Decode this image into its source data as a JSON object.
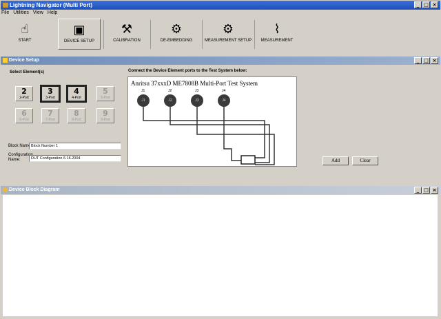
{
  "window": {
    "title": "Lightning Navigator (Multi Port)",
    "controls": [
      "_",
      "□",
      "×"
    ]
  },
  "menu": [
    "File",
    "Utilities",
    "View",
    "Help"
  ],
  "toolbar": [
    {
      "label": "START",
      "icon": "hand-pointer-icon",
      "glyph": "☝"
    },
    {
      "label": "DEVICE SETUP",
      "icon": "chip-icon",
      "glyph": "▣"
    },
    {
      "label": "CALIBRATION",
      "icon": "wrench-icon",
      "glyph": "⚒"
    },
    {
      "label": "DE-EMBEDDING",
      "icon": "network-icon",
      "glyph": "⚙"
    },
    {
      "label": "MEASUREMENT SETUP",
      "icon": "instrument-icon",
      "glyph": "⚙"
    },
    {
      "label": "MEASUREMENT",
      "icon": "graph-icon",
      "glyph": "⌇"
    }
  ],
  "device_setup": {
    "title": "Device Setup",
    "select_label": "Select Element(s)",
    "connect_label": "Connect the Device Element ports to the Test System below:",
    "devices": [
      {
        "num": "2",
        "label": "2-Port",
        "state": "enabled"
      },
      {
        "num": "3",
        "label": "3-Port",
        "state": "selected"
      },
      {
        "num": "4",
        "label": "4-Port",
        "state": "selected"
      },
      {
        "num": "5",
        "label": "5-Port",
        "state": "disabled"
      },
      {
        "num": "6",
        "label": "6-Port",
        "state": "disabled"
      },
      {
        "num": "7",
        "label": "7-Port",
        "state": "disabled"
      },
      {
        "num": "8",
        "label": "8-Port",
        "state": "disabled"
      },
      {
        "num": "9",
        "label": "9-Port",
        "state": "disabled"
      }
    ],
    "block_name_label": "Block Name:",
    "block_name_value": "Block Number 1",
    "config_label_1": "Configuration",
    "config_label_2": "Name:",
    "config_value": "DUT Configuration 6.16.2004",
    "test_system": "Anritsu 37xxxD ME7808B Multi-Port Test System",
    "ports": [
      {
        "top_label": "J1",
        "label": "J1"
      },
      {
        "top_label": "J2",
        "label": "J2"
      },
      {
        "top_label": "J3",
        "label": "J3"
      },
      {
        "top_label": "J4",
        "label": "J4"
      }
    ],
    "add_label": "Add",
    "clear_label": "Clear"
  },
  "device_block": {
    "title": "Device Block Diagram"
  }
}
